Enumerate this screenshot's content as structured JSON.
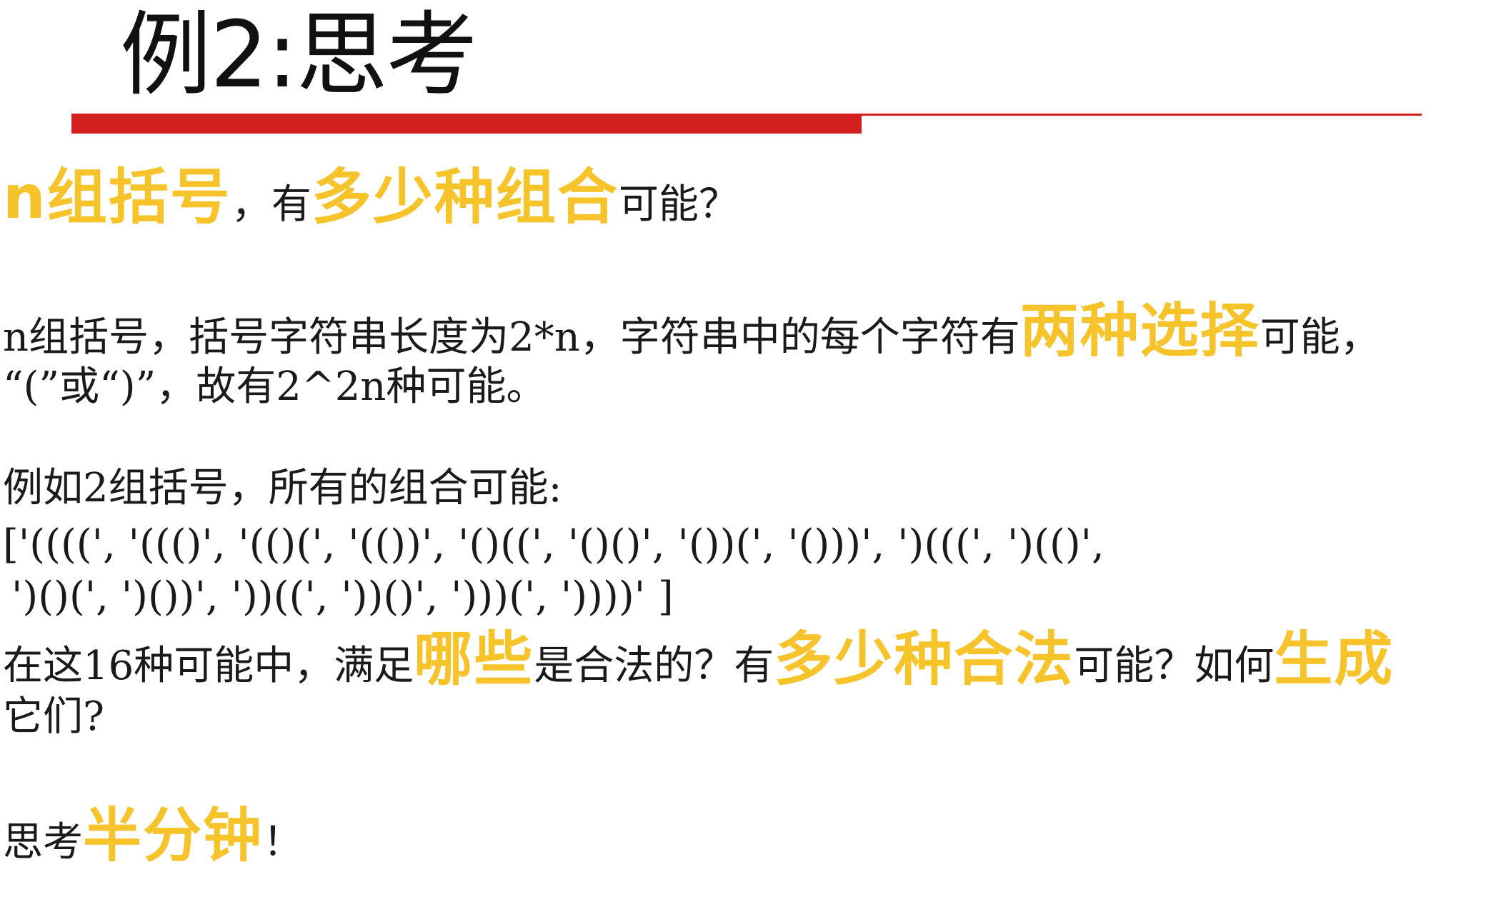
{
  "slide": {
    "title": "例2:思考"
  },
  "question": {
    "part1": "n组括号",
    "part2": "，有",
    "part3": "多少种组合",
    "part4": "可能？"
  },
  "explanation": {
    "line1_pre": "n组括号，括号字符串长度为2*n，字符串中的每个字符有",
    "line1_hl": "两种选择",
    "line1_post": "可能，",
    "line2": "“(”或“)”，故有2^2n种可能。"
  },
  "example": {
    "intro": "例如2组括号，所有的组合可能:",
    "combos_line1": "['((((', '((()', '(()(', '(())', '()((', '()()', '())(', '()))', ')(((', ')(()',",
    "combos_line2": "')()(', ')())', '))((', '))()', ')))(', '))))' ]"
  },
  "followup": {
    "pre": "在这16种可能中，满足",
    "hl1": "哪些",
    "mid1": "是合法的？有",
    "hl2": "多少种合法",
    "mid2": "可能？如何",
    "hl3": "生成",
    "line2": "它们?"
  },
  "closing": {
    "pre": "思考",
    "hl": "半分钟",
    "post": "！"
  },
  "colors": {
    "accent_red": "#d2201e",
    "highlight_yellow": "#f7c32b"
  }
}
